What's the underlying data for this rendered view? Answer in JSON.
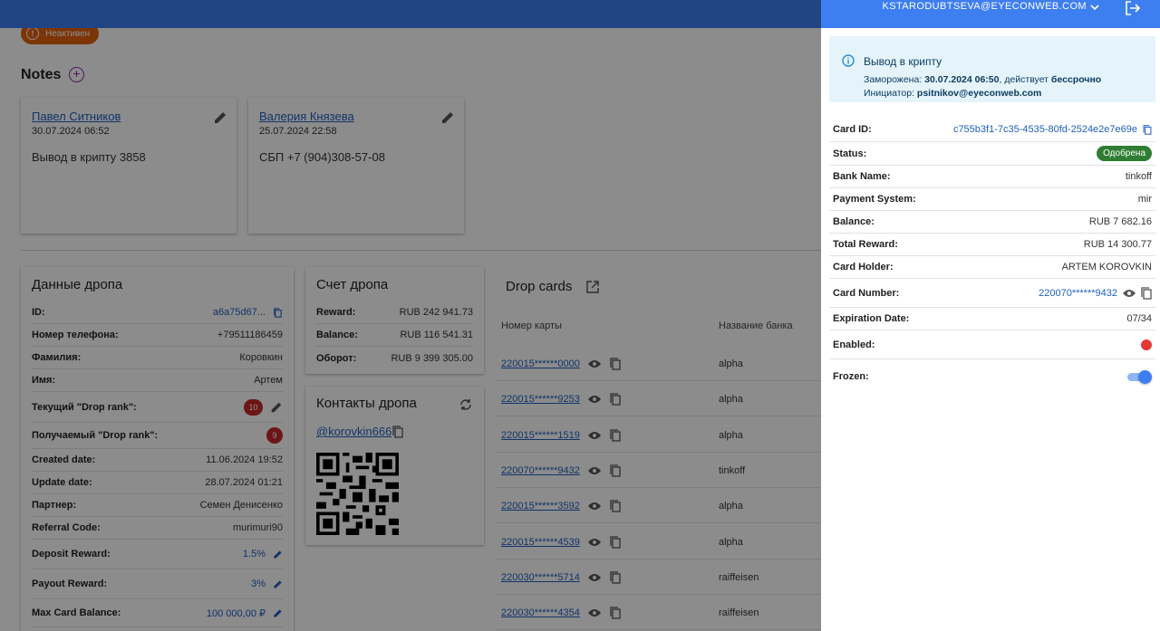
{
  "header": {
    "user_email": "KSTARODUBTSEVA@EYECONWEB.COM",
    "brand_color": "#3d7ef0"
  },
  "status_badge": {
    "label": "Неактивен",
    "color": "#e4600e",
    "icon": "info-icon"
  },
  "notes": {
    "title": "Notes",
    "items": [
      {
        "author": "Павел Ситников",
        "date": "30.07.2024 06:52",
        "text": "Вывод в крипту 3858"
      },
      {
        "author": "Валерия Князева",
        "date": "25.07.2024 22:58",
        "text": "СБП +7 (904)308-57-08"
      }
    ]
  },
  "drop_data": {
    "title": "Данные дропа",
    "rows": [
      {
        "label": "ID:",
        "value": "a6a75d67..."
      },
      {
        "label": "Номер телефона:",
        "value": "+79511186459"
      },
      {
        "label": "Фамилия:",
        "value": "Коровкин"
      },
      {
        "label": "Имя:",
        "value": "Артем"
      },
      {
        "label": "Текущий \"Drop rank\":",
        "value": "10"
      },
      {
        "label": "Получаемый \"Drop rank\":",
        "value": "9"
      },
      {
        "label": "Created date:",
        "value": "11.06.2024 19:52"
      },
      {
        "label": "Update date:",
        "value": "28.07.2024 01:21"
      },
      {
        "label": "Партнер:",
        "value": "Семен Денисенко"
      },
      {
        "label": "Referral Code:",
        "value": "murimuri90"
      },
      {
        "label": "Deposit Reward:",
        "value": "1.5%"
      },
      {
        "label": "Payout Reward:",
        "value": "3%"
      },
      {
        "label": "Max Card Balance:",
        "value": "100 000,00 ₽"
      }
    ]
  },
  "drop_account": {
    "title": "Счет дропа",
    "rows": [
      {
        "label": "Reward:",
        "value": "RUB 242 941.73"
      },
      {
        "label": "Balance:",
        "value": "RUB 116 541.31"
      },
      {
        "label": "Оборот:",
        "value": "RUB 9 399 305.00"
      }
    ]
  },
  "drop_contacts": {
    "title": "Контакты дропа",
    "handle": "@korovkin666"
  },
  "drop_cards": {
    "title": "Drop cards",
    "col_number": "Номер карты",
    "col_bank": "Название банка",
    "rows": [
      {
        "number": "220015******0000",
        "bank": "alpha"
      },
      {
        "number": "220015******9253",
        "bank": "alpha"
      },
      {
        "number": "220015******1519",
        "bank": "alpha"
      },
      {
        "number": "220070******9432",
        "bank": "tinkoff"
      },
      {
        "number": "220015******3592",
        "bank": "alpha"
      },
      {
        "number": "220015******4539",
        "bank": "alpha"
      },
      {
        "number": "220030******5714",
        "bank": "raiffeisen"
      },
      {
        "number": "220030******4354",
        "bank": "raiffeisen"
      }
    ]
  },
  "drawer": {
    "alert": {
      "title": "Вывод в крипту",
      "frozen_label": "Заморожена:",
      "frozen_date": "30.07.2024 06:50",
      "valid_label": ", действует",
      "valid_value": "бессрочно",
      "initiator_label": "Инициатор:",
      "initiator": "psitnikov@eyeconweb.com"
    },
    "card_id": {
      "label": "Card ID:",
      "value": "c755b3f1-7c35-4535-80fd-2524e2e7e69e"
    },
    "status": {
      "label": "Status:",
      "value": "Одобрена",
      "color": "#2e7d32"
    },
    "bank_name": {
      "label": "Bank Name:",
      "value": "tinkoff"
    },
    "payment_system": {
      "label": "Payment System:",
      "value": "mir"
    },
    "balance": {
      "label": "Balance:",
      "value": "RUB 7 682.16"
    },
    "total_reward": {
      "label": "Total Reward:",
      "value": "RUB 14 300.77"
    },
    "card_holder": {
      "label": "Card Holder:",
      "value": "ARTEM KOROVKIN"
    },
    "card_number": {
      "label": "Card Number:",
      "value": "220070******9432"
    },
    "expiration": {
      "label": "Expiration Date:",
      "value": "07/34"
    },
    "enabled": {
      "label": "Enabled:",
      "value": false,
      "indicator_color": "#e53935"
    },
    "frozen": {
      "label": "Frozen:",
      "value": true
    }
  }
}
